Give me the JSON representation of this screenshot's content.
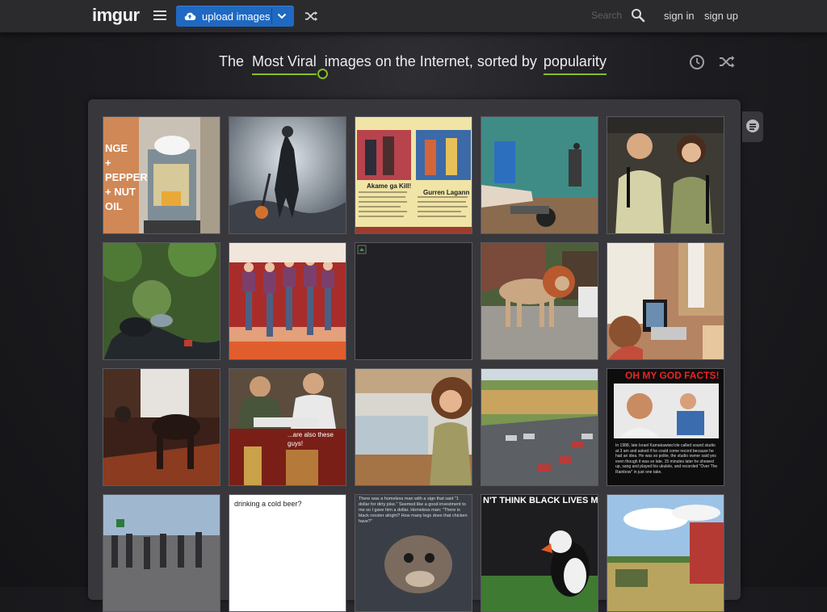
{
  "header": {
    "logo": "imgur",
    "upload_label": "upload images",
    "search_placeholder": "Search",
    "sign_in": "sign in",
    "sign_up": "sign up",
    "accent_color": "#1f69c2"
  },
  "headline": {
    "prefix": "The",
    "section": "Most Viral",
    "middle": "images on the Internet, sorted by",
    "sort": "popularity",
    "accent_color": "#85bf25"
  },
  "gallery": {
    "captions": {
      "tile_14": "...are also these guys!",
      "tile_15": "OH MY GOD FACTS!",
      "tile_15_body": "In 1988, late Israel Kamakawiwo'ole called sound studio at 3 am and asked if he could come record because he had an idea. He was so polite, the studio owner said yes even though it was so late. 15 minutes later he showed up, sang and played his ukulele, and recorded \"Over The Rainbow\" in just one take.",
      "tile_17": "drinking a cold beer?",
      "tile_18": "There was a homeless man with a sign that said \"1 dollar for dirty joke.\" Seemed like a good investment to me so I gave him a dollar. Homeless man: \"There is black rooster alright? How many legs does that chicken have?\"",
      "tile_19": "N'T THINK BLACK LIVES MAT",
      "tile_1": "NGE + PEPPER + NUT OIL",
      "tile_3_left": "Akame ga Kill!",
      "tile_3_right": "Gurren Lagann"
    }
  }
}
